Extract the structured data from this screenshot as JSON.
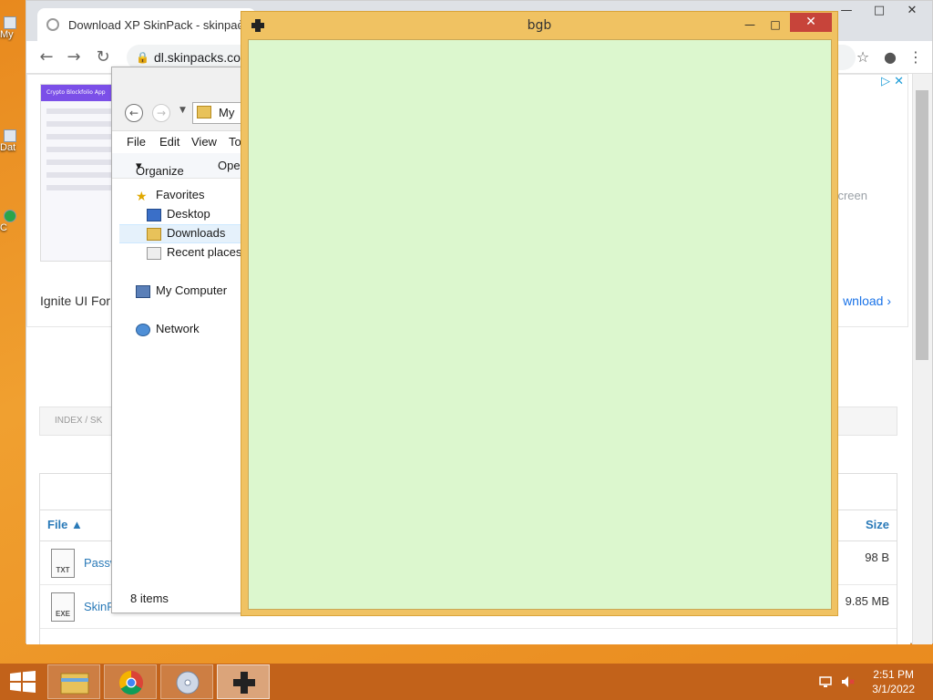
{
  "desktop": {
    "icons": [
      {
        "label": "My",
        "top": 0
      },
      {
        "label": "Dat",
        "top": 0
      },
      {
        "label": "C",
        "top": 0
      }
    ]
  },
  "chrome": {
    "tab_title": "Download XP SkinPack - skinpack",
    "url": "dl.skinpacks.com",
    "win_min": "—",
    "win_max": "□",
    "win_close": "✕"
  },
  "page": {
    "ad_thumb_title": "Crypto Blockfolio App",
    "ad_title": "Ignite UI For A",
    "ad_download": "wnload",
    "ad_fullscreen": "creen",
    "breadcrumb": "INDEX  /  SK",
    "table_headers": {
      "file": "File",
      "size": "Size"
    },
    "files": [
      {
        "type": "TXT",
        "name": "Passw",
        "size": "98 B"
      },
      {
        "type": "EXE",
        "name": "SkinP",
        "size": "9.85 MB"
      }
    ]
  },
  "explorer": {
    "address": "My",
    "menu": [
      "File",
      "Edit",
      "View",
      "To"
    ],
    "commands": {
      "organize": "Organize",
      "open": "Oper"
    },
    "nav": {
      "favorites": "Favorites",
      "desktop": "Desktop",
      "downloads": "Downloads",
      "recent": "Recent places",
      "computer": "My Computer",
      "network": "Network"
    },
    "status": "8 items"
  },
  "bgb": {
    "title": "bgb",
    "min": "—",
    "max": "□",
    "close": "✕",
    "screen_color": "#dcf7ce"
  },
  "taskbar": {
    "time": "2:51 PM",
    "date": "3/1/2022"
  }
}
